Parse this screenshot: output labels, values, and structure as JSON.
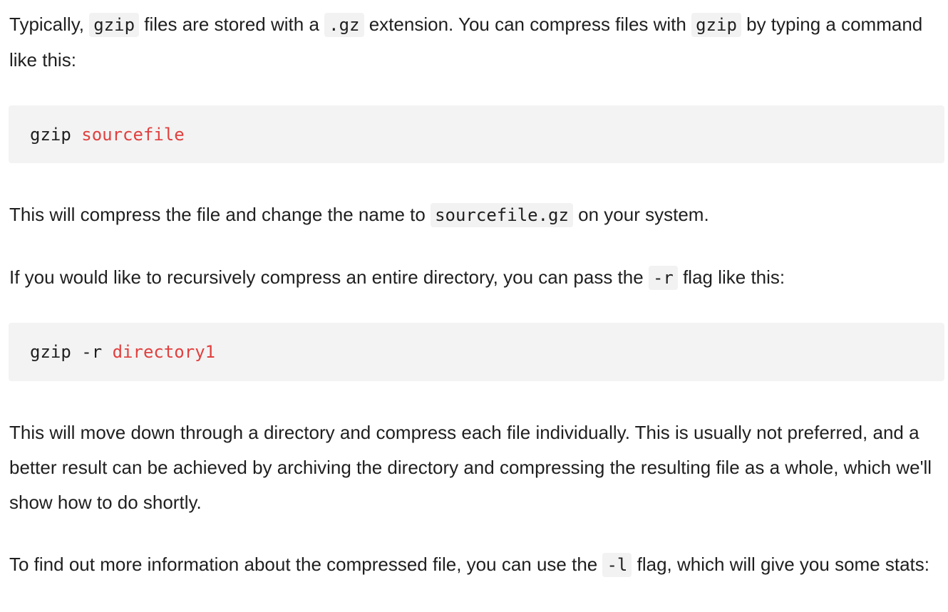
{
  "paragraphs": {
    "p1": {
      "t1": "Typically, ",
      "c1": "gzip",
      "t2": " files are stored with a ",
      "c2": ".gz",
      "t3": " extension. You can compress files with ",
      "c3": "gzip",
      "t4": " by typing a command like this:"
    },
    "p2": {
      "t1": "This will compress the file and change the name to ",
      "c1": "sourcefile.gz",
      "t2": " on your system."
    },
    "p3": {
      "t1": "If you would like to recursively compress an entire directory, you can pass the ",
      "c1": "-r",
      "t2": " flag like this:"
    },
    "p4": {
      "text": "This will move down through a directory and compress each file individually. This is usually not preferred, and a better result can be achieved by archiving the directory and compressing the resulting file as a whole, which we'll show how to do shortly."
    },
    "p5": {
      "t1": "To find out more information about the compressed file, you can use the ",
      "c1": "-l",
      "t2": " flag, which will give you some stats:"
    }
  },
  "code_blocks": {
    "cb1": {
      "command": "gzip ",
      "argument": "sourcefile"
    },
    "cb2": {
      "command": "gzip -r ",
      "argument": "directory1"
    }
  },
  "colors": {
    "code_argument": "#e0403f",
    "code_background": "#f3f3f3",
    "text": "#1f1f1f"
  }
}
